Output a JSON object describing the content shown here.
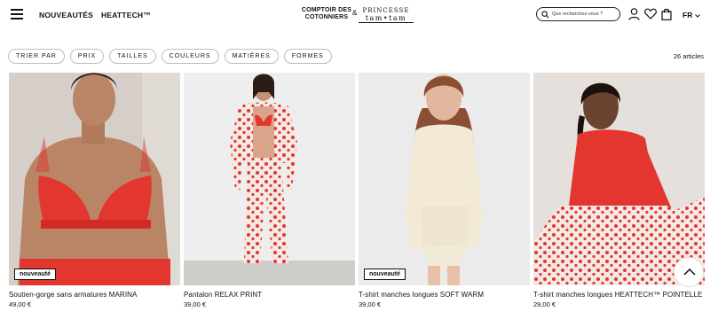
{
  "header": {
    "nav": [
      "NOUVEAUTÉS",
      "HEATTECH™"
    ],
    "logo_left": [
      "COMPTOIR DES",
      "COTONNIERS"
    ],
    "logo_and": "&",
    "logo_right": [
      "PRINCESSE",
      "tam•tam"
    ],
    "search_placeholder": "Que recherchez-vous ?",
    "language": "FR"
  },
  "filters": [
    "TRIER PAR",
    "PRIX",
    "TAILLES",
    "COULEURS",
    "MATIÈRES",
    "FORMES"
  ],
  "result_count": "26 articles",
  "products": [
    {
      "name": "Soutien-gorge sans armatures MARINA",
      "price": "49,00 €",
      "badge": "nouveauté"
    },
    {
      "name": "Pantalon RELAX PRINT",
      "price": "39,00 €",
      "badge": ""
    },
    {
      "name": "T-shirt manches longues SOFT WARM",
      "price": "39,00 €",
      "badge": "nouveauté"
    },
    {
      "name": "T-shirt manches longues HEATTECH™ POINTELLE",
      "price": "29,00 €",
      "badge": ""
    }
  ],
  "colors": {
    "accent_red": "#e2362f",
    "text": "#111111",
    "chip_border": "#bdbdbd"
  }
}
